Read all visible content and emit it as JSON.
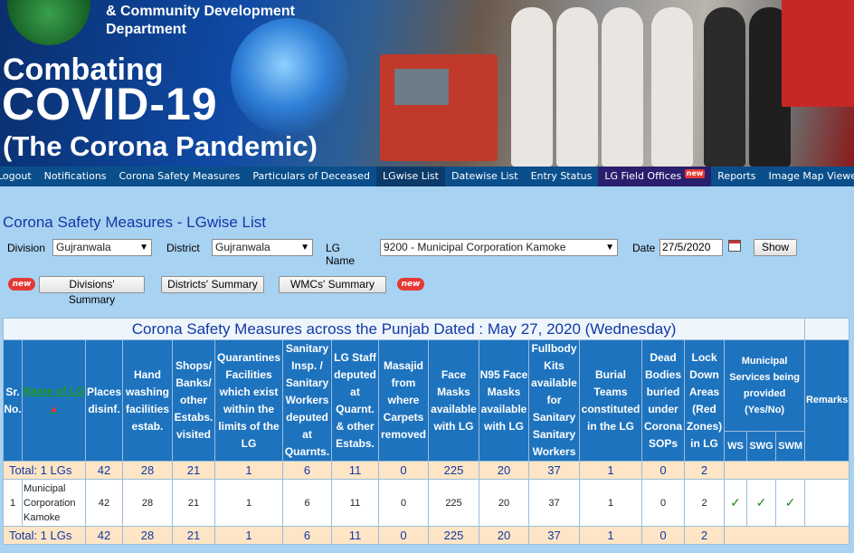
{
  "banner": {
    "dept_line1": "& Community Development",
    "dept_line2": "Department",
    "title_line1": "Combating",
    "title_line2": "COVID-19",
    "title_line3": "(The Corona Pandemic)"
  },
  "nav": {
    "items": [
      {
        "label": "Logout"
      },
      {
        "label": "Notifications"
      },
      {
        "label": "Corona Safety Measures"
      },
      {
        "label": "Particulars of Deceased"
      },
      {
        "label": "LGwise List"
      },
      {
        "label": "Datewise List"
      },
      {
        "label": "Entry Status"
      },
      {
        "label": "LG Field Offices"
      },
      {
        "label": "Reports"
      },
      {
        "label": "Image Map Viewer"
      }
    ],
    "new_badge": "new"
  },
  "page": {
    "title": "Corona Safety Measures - LGwise List"
  },
  "filters": {
    "division_label": "Division",
    "division_value": "Gujranwala",
    "district_label": "District",
    "district_value": "Gujranwala",
    "lgname_label": "LG Name",
    "lgname_value": "9200 - Municipal Corporation Kamoke",
    "date_label": "Date",
    "date_value": "27/5/2020",
    "show_button": "Show"
  },
  "summaries": {
    "new_label": "new",
    "divisions": "Divisions' Summary",
    "districts": "Districts' Summary",
    "wmcs": "WMCs' Summary"
  },
  "table": {
    "caption": "Corona Safety Measures across the Punjab Dated : May 27, 2020 (Wednesday)",
    "headers": {
      "sr": "Sr. No.",
      "name": "Name of LG",
      "places": "Places disinf.",
      "hand": "Hand washing facilities estab.",
      "shops": "Shops/ Banks/ other Estabs. visited",
      "quarantines": "Quarantines Facilities which exist within the limits of the LG",
      "sanitary": "Sanitary Insp. / Sanitary Workers deputed at Quarnts.",
      "lgstaff": "LG Staff deputed at Quarnt. & other Estabs.",
      "masajid": "Masajid from where Carpets removed",
      "facemasks": "Face Masks available with LG",
      "n95": "N95 Face Masks available with LG",
      "fullbody": "Fullbody Kits available for Sanitary Sanitary Workers",
      "burial": "Burial Teams constituted in the LG",
      "dead": "Dead Bodies buried under Corona SOPs",
      "lockdown": "Lock Down Areas (Red Zones) in LG",
      "municipal": "Municipal Services being provided (Yes/No)",
      "remarks": "Remarks",
      "ws": "WS",
      "swg": "SWG",
      "swm": "SWM"
    },
    "total": {
      "label": "Total: 1 LGs",
      "values": [
        "42",
        "28",
        "21",
        "1",
        "6",
        "11",
        "0",
        "225",
        "20",
        "37",
        "1",
        "0",
        "2"
      ]
    },
    "rows": [
      {
        "sr": "1",
        "name": "Municipal Corporation Kamoke",
        "values": [
          "42",
          "28",
          "21",
          "1",
          "6",
          "11",
          "0",
          "225",
          "20",
          "37",
          "1",
          "0",
          "2"
        ],
        "ws": "✓",
        "swg": "✓",
        "swm": "✓",
        "remarks": ""
      }
    ]
  }
}
